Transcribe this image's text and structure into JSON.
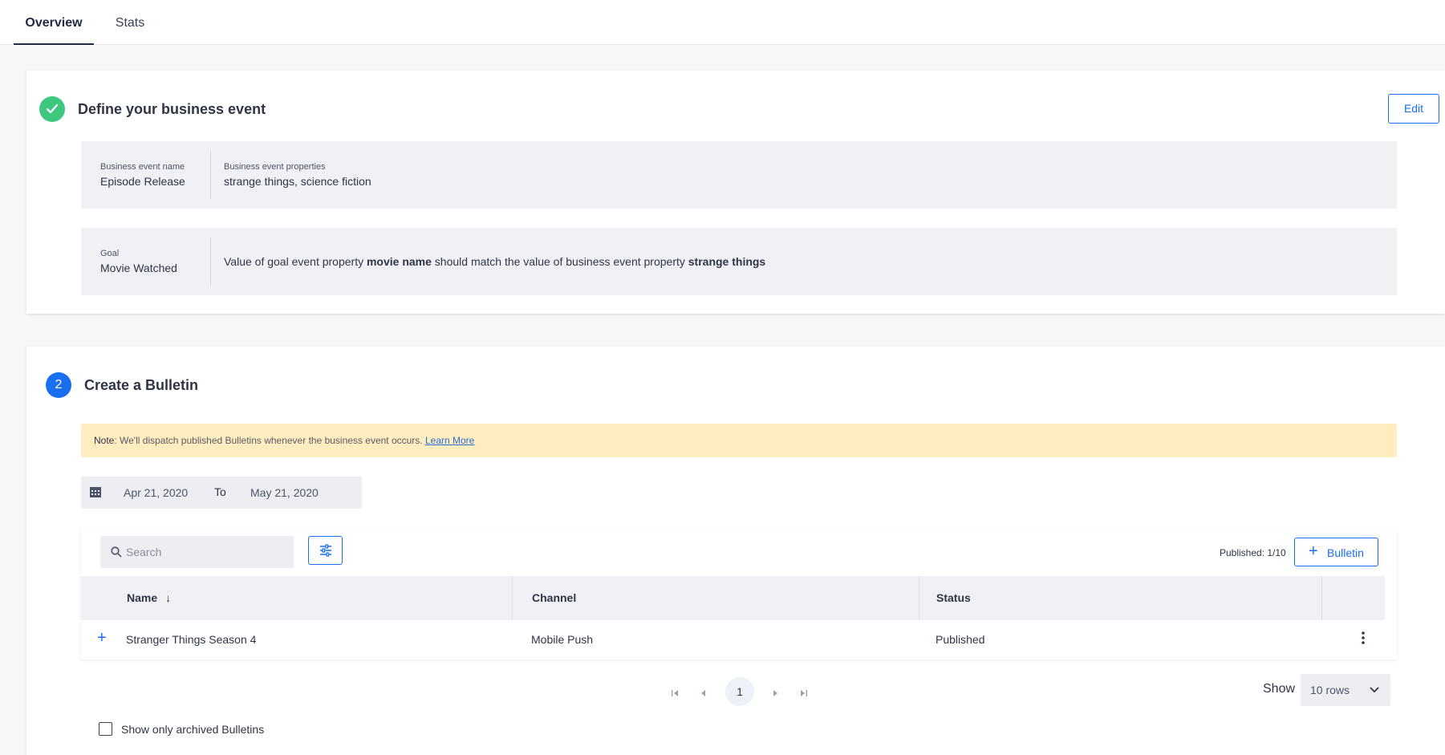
{
  "tabs": [
    {
      "label": "Overview",
      "active": true
    },
    {
      "label": "Stats",
      "active": false
    }
  ],
  "step1": {
    "title": "Define your business event",
    "edit_label": "Edit",
    "event_name_label": "Business event name",
    "event_name_value": "Episode Release",
    "event_props_label": "Business event properties",
    "event_props_value": "strange things, science fiction",
    "goal_label": "Goal",
    "goal_value": "Movie Watched",
    "goal_text_1": "Value of goal event property ",
    "goal_bold_1": "movie name",
    "goal_text_2": " should match the value of business event property ",
    "goal_bold_2": "strange things"
  },
  "step2": {
    "number": "2",
    "title": "Create a Bulletin",
    "note_label": "Note",
    "note_text": ": We'll dispatch published Bulletins whenever the business event occurs. ",
    "note_link": "Learn More",
    "date_from": "Apr 21, 2020",
    "date_to_label": "To",
    "date_to": "May 21, 2020",
    "search_placeholder": "Search",
    "published_text": "Published: 1/10",
    "bulletin_button": "Bulletin",
    "columns": {
      "name": "Name",
      "channel": "Channel",
      "status": "Status"
    },
    "rows": [
      {
        "name": "Stranger Things Season 4",
        "channel": "Mobile Push",
        "status": "Published"
      }
    ],
    "pagination": {
      "current_page": "1"
    },
    "show_label": "Show",
    "rows_select": "10 rows",
    "archived_label": "Show only archived Bulletins"
  },
  "colors": {
    "accent": "#1a6ef0",
    "success": "#3ec87f",
    "note_bg": "#fdedbf"
  }
}
